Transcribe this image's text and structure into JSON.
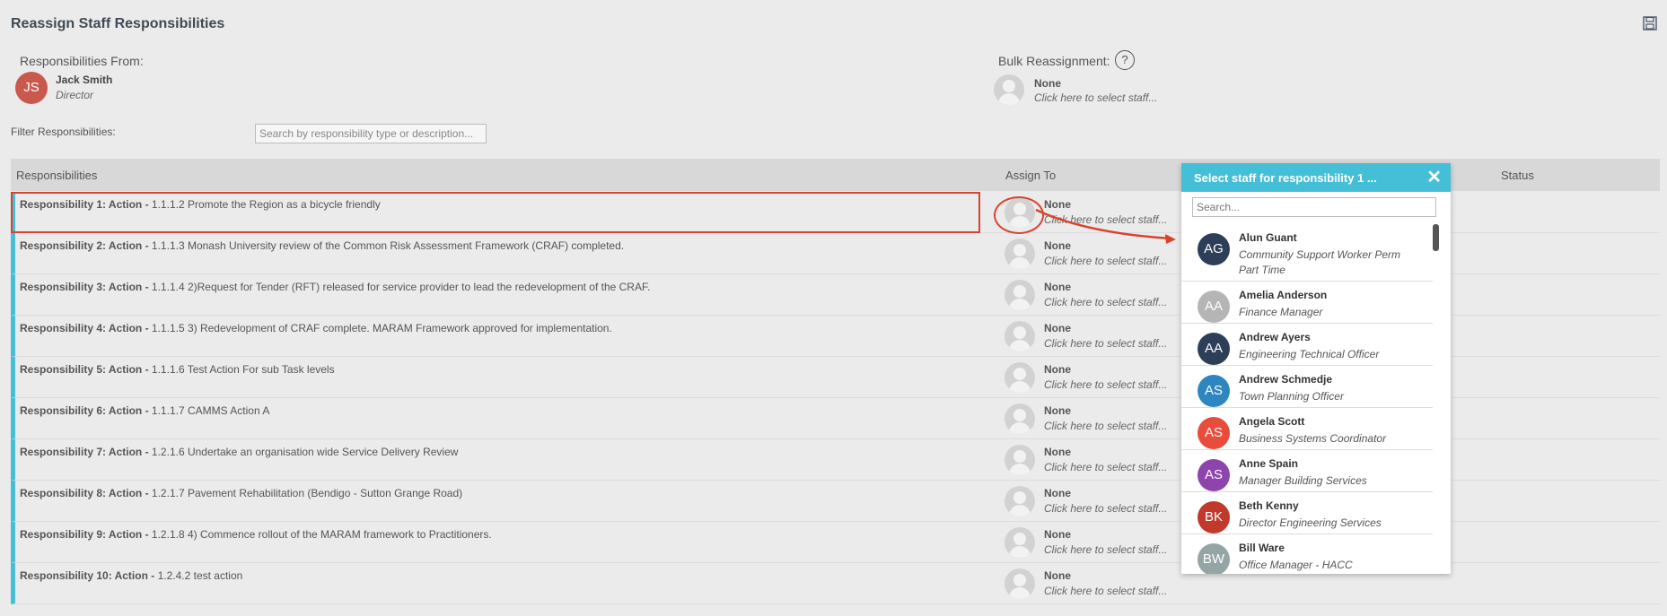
{
  "page": {
    "title": "Reassign Staff Responsibilities"
  },
  "from": {
    "label": "Responsibilities From:",
    "initials": "JS",
    "name": "Jack Smith",
    "role": "Director"
  },
  "bulk": {
    "label": "Bulk Reassignment:",
    "help": "?",
    "name": "None",
    "hint": "Click here to select staff..."
  },
  "filter": {
    "label": "Filter Responsibilities:",
    "placeholder": "Search by responsibility type or description..."
  },
  "table": {
    "headers": {
      "responsibilities": "Responsibilities",
      "assign_to": "Assign To",
      "status": "Status"
    },
    "rows": [
      {
        "label": "Responsibility 1: Action -",
        "desc": "1.1.1.2 Promote the Region as a bicycle friendly",
        "assign": "None",
        "hint": "Click here to select staff..."
      },
      {
        "label": "Responsibility 2: Action -",
        "desc": "1.1.1.3 Monash University review of the Common Risk Assessment Framework (CRAF) completed.",
        "assign": "None",
        "hint": "Click here to select staff..."
      },
      {
        "label": "Responsibility 3: Action -",
        "desc": "1.1.1.4 2)Request for Tender (RFT) released for service provider to lead the redevelopment of the CRAF.",
        "assign": "None",
        "hint": "Click here to select staff..."
      },
      {
        "label": "Responsibility 4: Action -",
        "desc": "1.1.1.5 3) Redevelopment of CRAF complete. MARAM Framework approved for implementation.",
        "assign": "None",
        "hint": "Click here to select staff..."
      },
      {
        "label": "Responsibility 5: Action -",
        "desc": "1.1.1.6 Test Action For sub Task levels",
        "assign": "None",
        "hint": "Click here to select staff..."
      },
      {
        "label": "Responsibility 6: Action -",
        "desc": "1.1.1.7 CAMMS Action A",
        "assign": "None",
        "hint": "Click here to select staff..."
      },
      {
        "label": "Responsibility 7: Action -",
        "desc": "1.2.1.6 Undertake an organisation wide Service Delivery Review",
        "assign": "None",
        "hint": "Click here to select staff..."
      },
      {
        "label": "Responsibility 8: Action -",
        "desc": "1.2.1.7 Pavement Rehabilitation (Bendigo - Sutton Grange Road)",
        "assign": "None",
        "hint": "Click here to select staff..."
      },
      {
        "label": "Responsibility 9: Action -",
        "desc": "1.2.1.8 4) Commence rollout of the MARAM framework to Practitioners.",
        "assign": "None",
        "hint": "Click here to select staff..."
      },
      {
        "label": "Responsibility 10: Action -",
        "desc": "1.2.4.2 test action",
        "assign": "None",
        "hint": "Click here to select staff..."
      }
    ]
  },
  "popup": {
    "title": "Select staff for responsibility 1 ...",
    "close": "✕",
    "search_placeholder": "Search...",
    "staff": [
      {
        "initials": "AG",
        "name": "Alun Guant",
        "role": "Community Support Worker Perm Part Time",
        "color": "#2c3e58"
      },
      {
        "initials": "AA",
        "name": "Amelia Anderson",
        "role": "Finance Manager",
        "color": "#b5b5b5"
      },
      {
        "initials": "AA",
        "name": "Andrew Ayers",
        "role": "Engineering Technical Officer",
        "color": "#2c3e58"
      },
      {
        "initials": "AS",
        "name": "Andrew Schmedje",
        "role": "Town Planning Officer",
        "color": "#2e86c1"
      },
      {
        "initials": "AS",
        "name": "Angela Scott",
        "role": "Business Systems Coordinator",
        "color": "#e74c3c"
      },
      {
        "initials": "AS",
        "name": "Anne Spain",
        "role": "Manager Building Services",
        "color": "#8e44ad"
      },
      {
        "initials": "BK",
        "name": "Beth Kenny",
        "role": "Director Engineering Services",
        "color": "#c0392b"
      },
      {
        "initials": "BW",
        "name": "Bill Ware",
        "role": "Office Manager - HACC",
        "color": "#95a5a6"
      }
    ]
  },
  "colors": {
    "accent": "#45bfd8",
    "highlight": "#d9432e"
  }
}
